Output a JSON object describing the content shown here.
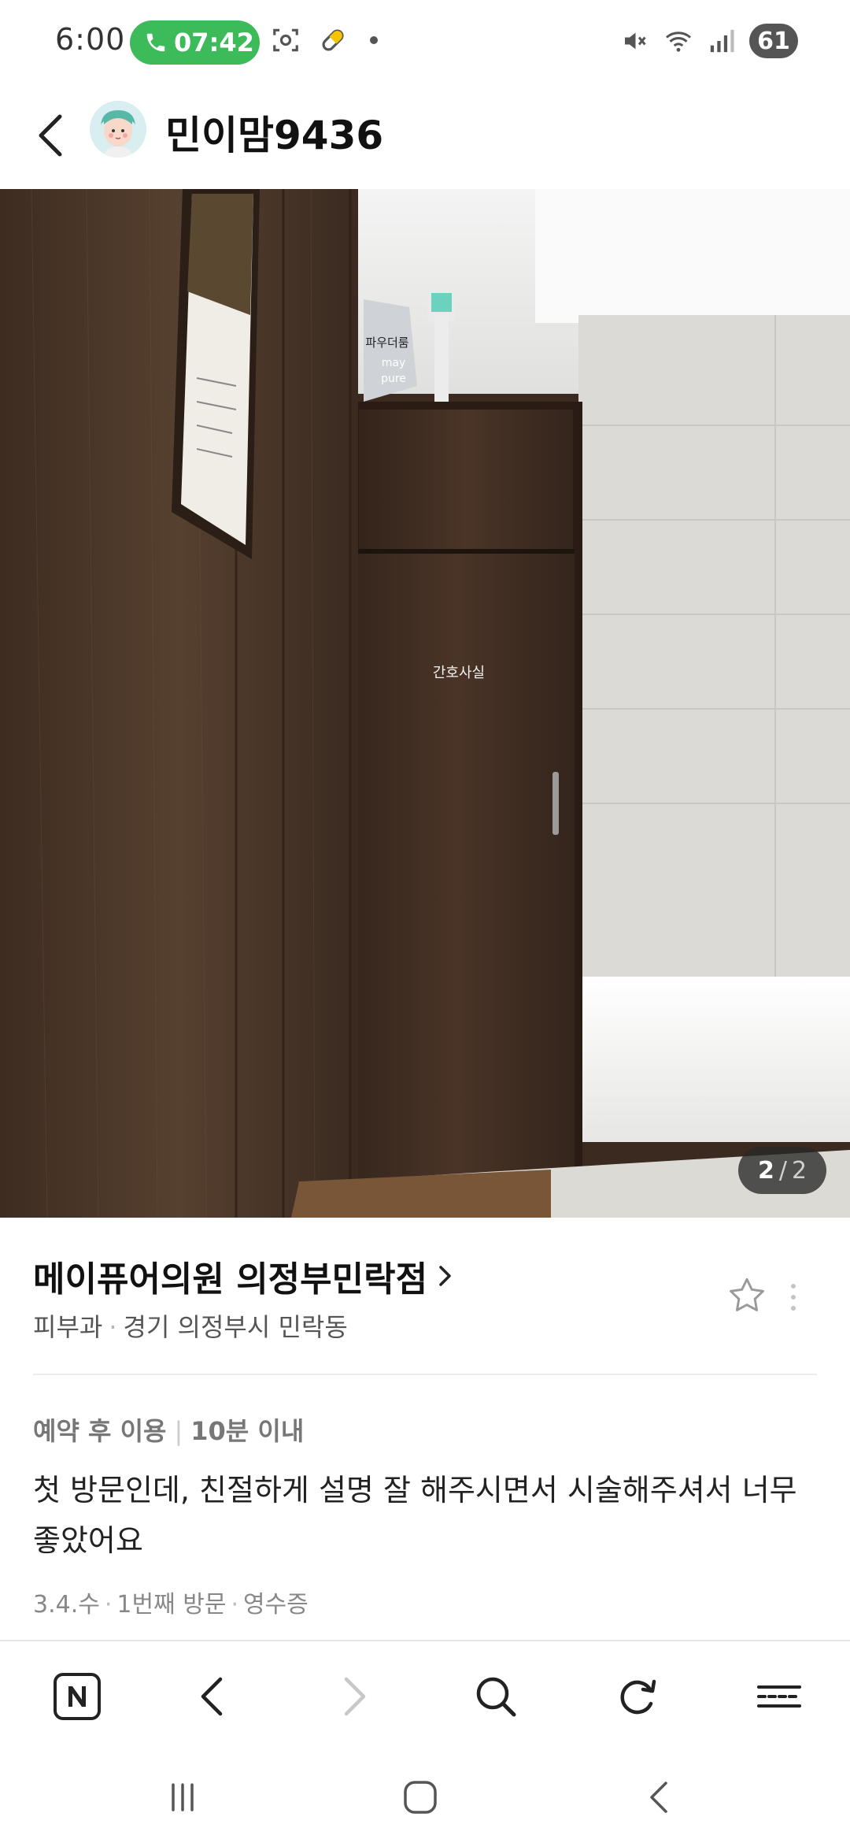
{
  "status_bar": {
    "time": "6:00",
    "call_timer": "07:42",
    "battery": "61",
    "icons": [
      "phone-icon",
      "screenshot-icon",
      "pill-icon",
      "notification-dot",
      "mute-icon",
      "wifi-icon",
      "signal-icon",
      "battery-icon"
    ]
  },
  "header": {
    "back_icon": "chevron-left-icon",
    "username": "민이맘9436"
  },
  "photo": {
    "door_sign": "간호사실",
    "wall_sign_line1": "파우더룸",
    "wall_sign_line2": "may",
    "wall_sign_line3": "pure",
    "page_current": "2",
    "page_separator": "/",
    "page_total": "2"
  },
  "place": {
    "name": "메이퓨어의원 의정부민락점",
    "category": "피부과",
    "location": "경기 의정부시 민락동",
    "separator": "·"
  },
  "review": {
    "tag_1": "예약 후 이용",
    "tag_separator": "|",
    "tag_2": "10분 이내",
    "text": "첫 방문인데, 친절하게 설명 잘 해주시면서 시술해주셔서 너무 좋았어요",
    "date": "3.4.수",
    "visit": "1번째 방문",
    "receipt": "영수증",
    "separator": "·"
  },
  "browser_toolbar": {
    "items": [
      "naver-home-icon",
      "back-icon",
      "forward-icon",
      "search-icon",
      "refresh-icon",
      "menu-icon"
    ]
  },
  "system_nav": {
    "items": [
      "recent-apps-icon",
      "home-icon",
      "back-icon"
    ]
  },
  "colors": {
    "call_pill": "#3dba59",
    "wood": "#4a3528",
    "text_primary": "#111111",
    "text_secondary": "#555555"
  }
}
